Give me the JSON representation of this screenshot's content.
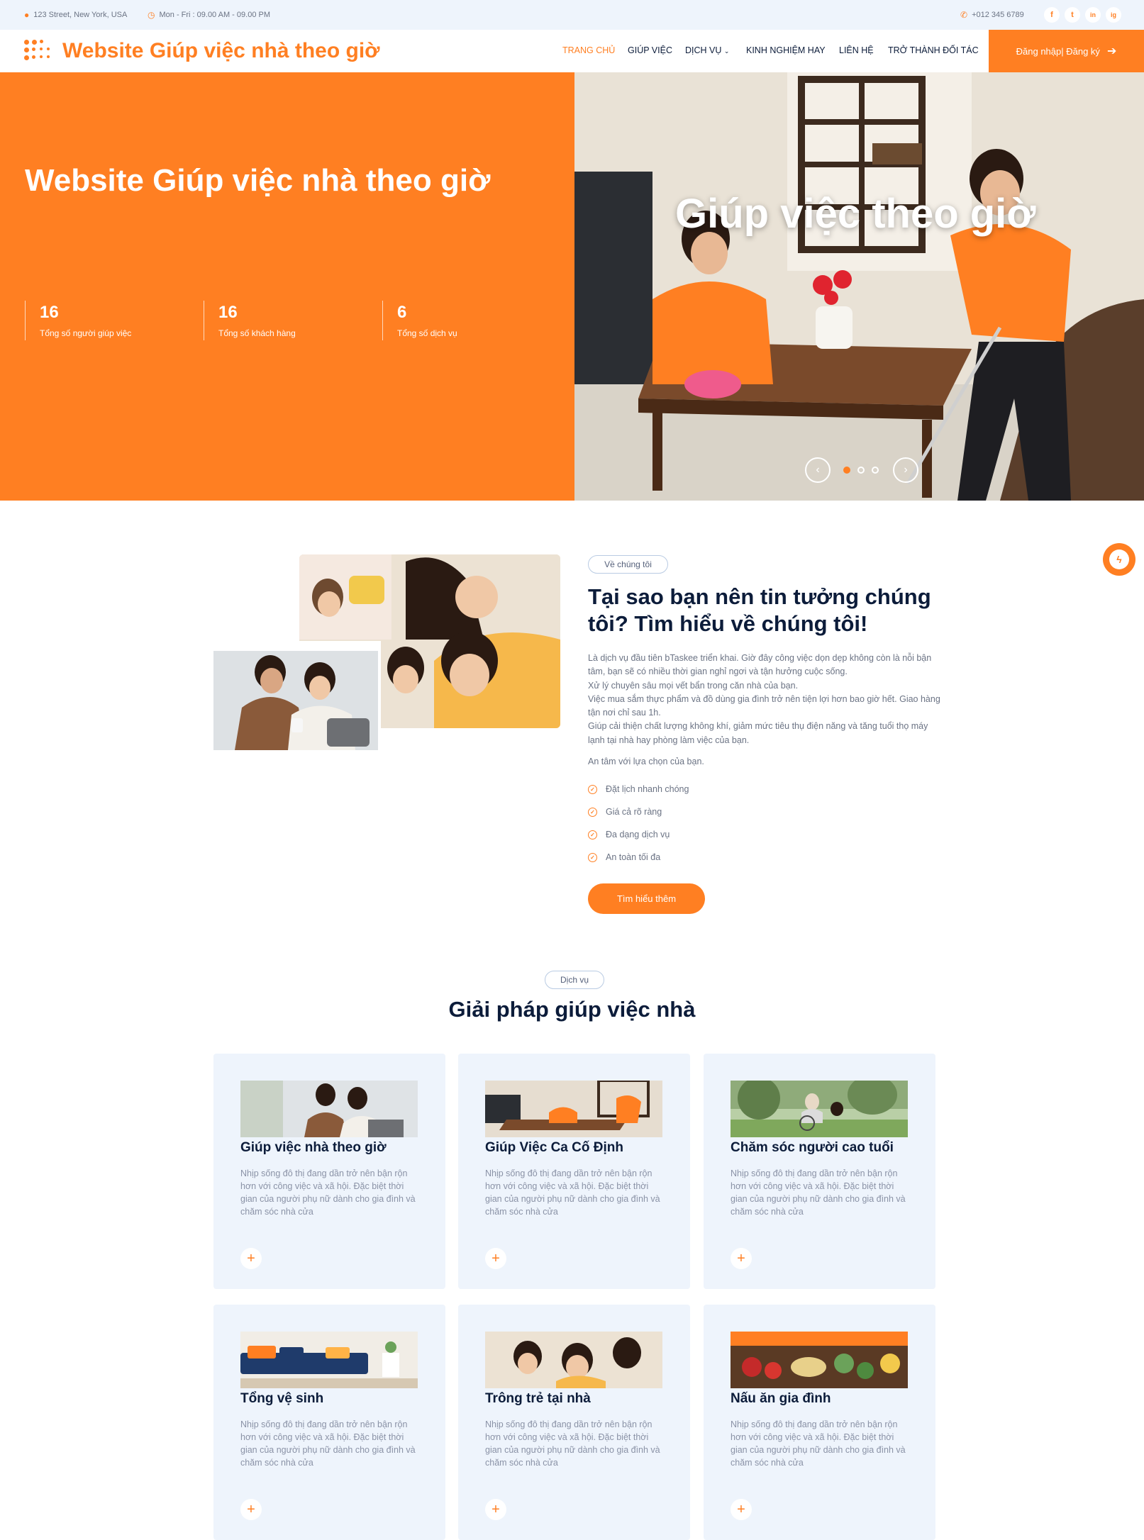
{
  "topbar": {
    "address": "123 Street, New York, USA",
    "hours": "Mon - Fri : 09.00 AM - 09.00 PM",
    "phone": "+012 345 6789",
    "social": [
      "f",
      "t",
      "in",
      "ig"
    ]
  },
  "nav": {
    "brand": "Website Giúp việc nhà theo giờ",
    "items": [
      {
        "label": "TRANG CHỦ",
        "active": true
      },
      {
        "label": "GIÚP VIỆC"
      },
      {
        "label": "DỊCH VỤ"
      },
      {
        "label": "KINH NGHIỆM HAY"
      },
      {
        "label": "LIÊN HỆ"
      },
      {
        "label": "TRỞ THÀNH ĐỐI TÁC"
      }
    ],
    "login_label": "Đăng nhập| Đăng ký"
  },
  "hero": {
    "title": "Website Giúp việc nhà theo giờ",
    "overlay": "Giúp việc theo giờ",
    "stats": [
      {
        "number": "16",
        "label": "Tổng số người giúp việc"
      },
      {
        "number": "16",
        "label": "Tổng số khách hàng"
      },
      {
        "number": "6",
        "label": "Tổng số dịch vụ"
      }
    ],
    "slide_count": 3,
    "active_slide": 1
  },
  "about": {
    "tag": "Về chúng tôi",
    "title": "Tại sao bạn nên tin tưởng chúng tôi? Tìm hiểu về chúng tôi!",
    "description": [
      "Là dịch vụ đầu tiên bTaskee triển khai. Giờ đây công việc dọn dẹp không còn là nỗi bận tâm, bạn sẽ có nhiều thời gian nghỉ ngơi và tận hưởng cuộc sống.",
      "Xử lý chuyên sâu mọi vết bẩn trong căn nhà của bạn.",
      "Việc mua sắm thực phẩm và đồ dùng gia đình trở nên tiện lợi hơn bao giờ hết. Giao hàng tận nơi chỉ sau 1h.",
      "Giúp cải thiện chất lượng không khí, giảm mức tiêu thụ điện năng và tăng tuổi thọ máy lạnh tại nhà hay phòng làm việc của bạn."
    ],
    "reassure": "An tâm với lựa chọn của bạn.",
    "checks": [
      "Đặt lịch nhanh chóng",
      "Giá cả rõ ràng",
      "Đa dạng dịch vụ",
      "An toàn tối đa"
    ],
    "button": "Tìm hiểu thêm"
  },
  "services": {
    "tag": "Dịch vụ",
    "title": "Giải pháp giúp việc nhà",
    "items": [
      {
        "title": "Giúp việc nhà theo giờ",
        "desc": "Nhịp sống đô thị đang dần trở nên bận rộn hơn với công việc và xã hội. Đặc biệt thời gian của người phụ nữ dành cho gia đình và chăm sóc nhà cửa"
      },
      {
        "title": "Giúp Việc Ca Cố Định",
        "desc": "Nhịp sống đô thị đang dần trở nên bận rộn hơn với công việc và xã hội. Đặc biệt thời gian của người phụ nữ dành cho gia đình và chăm sóc nhà cửa"
      },
      {
        "title": "Chăm sóc người cao tuổi",
        "desc": "Nhịp sống đô thị đang dần trở nên bận rộn hơn với công việc và xã hội. Đặc biệt thời gian của người phụ nữ dành cho gia đình và chăm sóc nhà cửa"
      },
      {
        "title": "Tổng vệ sinh",
        "desc": "Nhịp sống đô thị đang dần trở nên bận rộn hơn với công việc và xã hội. Đặc biệt thời gian của người phụ nữ dành cho gia đình và chăm sóc nhà cửa"
      },
      {
        "title": "Trông trẻ tại nhà",
        "desc": "Nhịp sống đô thị đang dần trở nên bận rộn hơn với công việc và xã hội. Đặc biệt thời gian của người phụ nữ dành cho gia đình và chăm sóc nhà cửa"
      },
      {
        "title": "Nấu ăn gia đình",
        "desc": "Nhịp sống đô thị đang dần trở nên bận rộn hơn với công việc và xã hội. Đặc biệt thời gian của người phụ nữ dành cho gia đình và chăm sóc nhà cửa"
      }
    ],
    "plus": "+"
  },
  "colors": {
    "accent": "#ff7f22",
    "navy": "#0c1c3a",
    "light_bg": "#eef4fc"
  }
}
